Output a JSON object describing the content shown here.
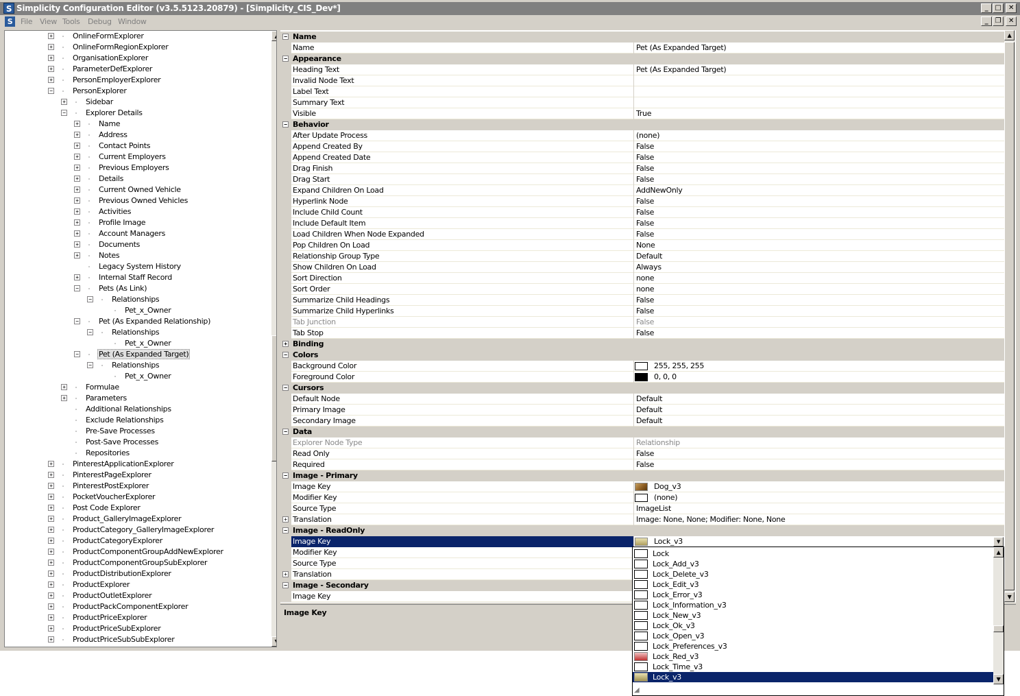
{
  "window": {
    "title": "Simplicity Configuration Editor (v3.5.5123.20879) - [Simplicity_CIS_Dev*]",
    "app_icon": "S"
  },
  "menu": [
    "File",
    "View",
    "Tools",
    "Debug",
    "Window"
  ],
  "tree": [
    {
      "label": "OnlineFormExplorer",
      "level": 0,
      "expander": "+"
    },
    {
      "label": "OnlineFormRegionExplorer",
      "level": 0,
      "expander": "+"
    },
    {
      "label": "OrganisationExplorer",
      "level": 0,
      "expander": "+"
    },
    {
      "label": "ParameterDefExplorer",
      "level": 0,
      "expander": "+"
    },
    {
      "label": "PersonEmployerExplorer",
      "level": 0,
      "expander": "+"
    },
    {
      "label": "PersonExplorer",
      "level": 0,
      "expander": "-"
    },
    {
      "label": "Sidebar",
      "level": 1,
      "expander": "+"
    },
    {
      "label": "Explorer Details",
      "level": 1,
      "expander": "-"
    },
    {
      "label": "Name",
      "level": 2,
      "expander": "+"
    },
    {
      "label": "Address",
      "level": 2,
      "expander": "+"
    },
    {
      "label": "Contact Points",
      "level": 2,
      "expander": "+"
    },
    {
      "label": "Current Employers",
      "level": 2,
      "expander": "+"
    },
    {
      "label": "Previous Employers",
      "level": 2,
      "expander": "+"
    },
    {
      "label": "Details",
      "level": 2,
      "expander": "+"
    },
    {
      "label": "Current Owned Vehicle",
      "level": 2,
      "expander": "+"
    },
    {
      "label": "Previous Owned Vehicles",
      "level": 2,
      "expander": "+"
    },
    {
      "label": "Activities",
      "level": 2,
      "expander": "+"
    },
    {
      "label": "Profile Image",
      "level": 2,
      "expander": "+"
    },
    {
      "label": "Account Managers",
      "level": 2,
      "expander": "+"
    },
    {
      "label": "Documents",
      "level": 2,
      "expander": "+"
    },
    {
      "label": "Notes",
      "level": 2,
      "expander": "+"
    },
    {
      "label": "Legacy System History",
      "level": 2,
      "expander": ""
    },
    {
      "label": "Internal Staff Record",
      "level": 2,
      "expander": "+"
    },
    {
      "label": "Pets (As Link)",
      "level": 2,
      "expander": "-"
    },
    {
      "label": "Relationships",
      "level": 3,
      "expander": "-"
    },
    {
      "label": "Pet_x_Owner",
      "level": 4,
      "expander": ""
    },
    {
      "label": "Pet (As Expanded Relationship)",
      "level": 2,
      "expander": "-"
    },
    {
      "label": "Relationships",
      "level": 3,
      "expander": "-"
    },
    {
      "label": "Pet_x_Owner",
      "level": 4,
      "expander": ""
    },
    {
      "label": "Pet (As Expanded Target)",
      "level": 2,
      "expander": "-",
      "selected": true
    },
    {
      "label": "Relationships",
      "level": 3,
      "expander": "-"
    },
    {
      "label": "Pet_x_Owner",
      "level": 4,
      "expander": ""
    },
    {
      "label": "Formulae",
      "level": 1,
      "expander": "+"
    },
    {
      "label": "Parameters",
      "level": 1,
      "expander": "+"
    },
    {
      "label": "Additional Relationships",
      "level": 1,
      "expander": ""
    },
    {
      "label": "Exclude Relationships",
      "level": 1,
      "expander": ""
    },
    {
      "label": "Pre-Save Processes",
      "level": 1,
      "expander": ""
    },
    {
      "label": "Post-Save Processes",
      "level": 1,
      "expander": ""
    },
    {
      "label": "Repositories",
      "level": 1,
      "expander": ""
    },
    {
      "label": "PinterestApplicationExplorer",
      "level": 0,
      "expander": "+"
    },
    {
      "label": "PinterestPageExplorer",
      "level": 0,
      "expander": "+"
    },
    {
      "label": "PinterestPostExplorer",
      "level": 0,
      "expander": "+"
    },
    {
      "label": "PocketVoucherExplorer",
      "level": 0,
      "expander": "+"
    },
    {
      "label": "Post Code Explorer",
      "level": 0,
      "expander": "+"
    },
    {
      "label": "Product_GalleryImageExplorer",
      "level": 0,
      "expander": "+"
    },
    {
      "label": "ProductCategory_GalleryImageExplorer",
      "level": 0,
      "expander": "+"
    },
    {
      "label": "ProductCategoryExplorer",
      "level": 0,
      "expander": "+"
    },
    {
      "label": "ProductComponentGroupAddNewExplorer",
      "level": 0,
      "expander": "+"
    },
    {
      "label": "ProductComponentGroupSubExplorer",
      "level": 0,
      "expander": "+"
    },
    {
      "label": "ProductDistributionExplorer",
      "level": 0,
      "expander": "+"
    },
    {
      "label": "ProductExplorer",
      "level": 0,
      "expander": "+"
    },
    {
      "label": "ProductOutletExplorer",
      "level": 0,
      "expander": "+"
    },
    {
      "label": "ProductPackComponentExplorer",
      "level": 0,
      "expander": "+"
    },
    {
      "label": "ProductPriceExplorer",
      "level": 0,
      "expander": "+"
    },
    {
      "label": "ProductPriceSubExplorer",
      "level": 0,
      "expander": "+"
    },
    {
      "label": "ProductPriceSubSubExplorer",
      "level": 0,
      "expander": "+"
    }
  ],
  "properties": [
    {
      "type": "group",
      "label": "Name",
      "expander": "-"
    },
    {
      "type": "prop",
      "name": "Name",
      "value": "Pet (As Expanded Target)"
    },
    {
      "type": "group",
      "label": "Appearance",
      "expander": "-"
    },
    {
      "type": "prop",
      "name": "Heading Text",
      "value": "Pet (As Expanded Target)"
    },
    {
      "type": "prop",
      "name": "Invalid Node Text",
      "value": ""
    },
    {
      "type": "prop",
      "name": "Label Text",
      "value": ""
    },
    {
      "type": "prop",
      "name": "Summary Text",
      "value": ""
    },
    {
      "type": "prop",
      "name": "Visible",
      "value": "True"
    },
    {
      "type": "group",
      "label": "Behavior",
      "expander": "-"
    },
    {
      "type": "prop",
      "name": "After Update Process",
      "value": "(none)"
    },
    {
      "type": "prop",
      "name": "Append Created By",
      "value": "False"
    },
    {
      "type": "prop",
      "name": "Append Created Date",
      "value": "False"
    },
    {
      "type": "prop",
      "name": "Drag Finish",
      "value": "False"
    },
    {
      "type": "prop",
      "name": "Drag Start",
      "value": "False"
    },
    {
      "type": "prop",
      "name": "Expand Children On Load",
      "value": "AddNewOnly"
    },
    {
      "type": "prop",
      "name": "Hyperlink Node",
      "value": "False"
    },
    {
      "type": "prop",
      "name": "Include Child Count",
      "value": "False"
    },
    {
      "type": "prop",
      "name": "Include Default Item",
      "value": "False"
    },
    {
      "type": "prop",
      "name": "Load Children When Node Expanded",
      "value": "False"
    },
    {
      "type": "prop",
      "name": "Pop Children On Load",
      "value": "None"
    },
    {
      "type": "prop",
      "name": "Relationship Group Type",
      "value": "Default"
    },
    {
      "type": "prop",
      "name": "Show Children On Load",
      "value": "Always"
    },
    {
      "type": "prop",
      "name": "Sort Direction",
      "value": "none"
    },
    {
      "type": "prop",
      "name": "Sort Order",
      "value": "none"
    },
    {
      "type": "prop",
      "name": "Summarize Child Headings",
      "value": "False"
    },
    {
      "type": "prop",
      "name": "Summarize Child Hyperlinks",
      "value": "False"
    },
    {
      "type": "prop",
      "name": "Tab Junction",
      "value": "False",
      "disabled": true
    },
    {
      "type": "prop",
      "name": "Tab Stop",
      "value": "False"
    },
    {
      "type": "group",
      "label": "Binding",
      "expander": "+"
    },
    {
      "type": "group",
      "label": "Colors",
      "expander": "-"
    },
    {
      "type": "prop",
      "name": "Background Color",
      "value": "255, 255, 255",
      "swatch": "#ffffff"
    },
    {
      "type": "prop",
      "name": "Foreground Color",
      "value": "0, 0, 0",
      "swatch": "#000000"
    },
    {
      "type": "group",
      "label": "Cursors",
      "expander": "-"
    },
    {
      "type": "prop",
      "name": "Default Node",
      "value": "Default"
    },
    {
      "type": "prop",
      "name": "Primary Image",
      "value": "Default"
    },
    {
      "type": "prop",
      "name": "Secondary Image",
      "value": "Default"
    },
    {
      "type": "group",
      "label": "Data",
      "expander": "-"
    },
    {
      "type": "prop",
      "name": "Explorer Node Type",
      "value": "Relationship",
      "disabled": true
    },
    {
      "type": "prop",
      "name": "Read Only",
      "value": "False"
    },
    {
      "type": "prop",
      "name": "Required",
      "value": "False"
    },
    {
      "type": "group",
      "label": "Image - Primary",
      "expander": "-"
    },
    {
      "type": "prop",
      "name": "Image Key",
      "value": "Dog_v3",
      "swatch": "dog"
    },
    {
      "type": "prop",
      "name": "Modifier Key",
      "value": "(none)",
      "swatch": "#ffffff"
    },
    {
      "type": "prop",
      "name": "Source Type",
      "value": "ImageList"
    },
    {
      "type": "prop",
      "name": "Translation",
      "value": "Image: None, None; Modifier: None, None",
      "expander": "+"
    },
    {
      "type": "group",
      "label": "Image - ReadOnly",
      "expander": "-"
    },
    {
      "type": "prop",
      "name": "Image Key",
      "value": "Lock_v3",
      "swatch": "lock",
      "selected": true
    },
    {
      "type": "prop",
      "name": "Modifier Key",
      "value": ""
    },
    {
      "type": "prop",
      "name": "Source Type",
      "value": ""
    },
    {
      "type": "prop",
      "name": "Translation",
      "value": "",
      "expander": "+"
    },
    {
      "type": "group",
      "label": "Image - Secondary",
      "expander": "-"
    },
    {
      "type": "prop",
      "name": "Image Key",
      "value": ""
    }
  ],
  "description": {
    "title": "Image Key"
  },
  "dropdown": {
    "items": [
      {
        "label": "Lock",
        "icon": "blank"
      },
      {
        "label": "Lock_Add_v3",
        "icon": "blank"
      },
      {
        "label": "Lock_Delete_v3",
        "icon": "blank"
      },
      {
        "label": "Lock_Edit_v3",
        "icon": "blank"
      },
      {
        "label": "Lock_Error_v3",
        "icon": "blank"
      },
      {
        "label": "Lock_Information_v3",
        "icon": "blank"
      },
      {
        "label": "Lock_New_v3",
        "icon": "blank"
      },
      {
        "label": "Lock_Ok_v3",
        "icon": "blank"
      },
      {
        "label": "Lock_Open_v3",
        "icon": "blank"
      },
      {
        "label": "Lock_Preferences_v3",
        "icon": "blank"
      },
      {
        "label": "Lock_Red_v3",
        "icon": "red-lock"
      },
      {
        "label": "Lock_Time_v3",
        "icon": "blank"
      },
      {
        "label": "Lock_v3",
        "icon": "lock",
        "selected": true
      }
    ]
  },
  "colors": {
    "selection": "#0a246a",
    "group_bg": "#d4d0c8",
    "title_bg": "#808080"
  }
}
